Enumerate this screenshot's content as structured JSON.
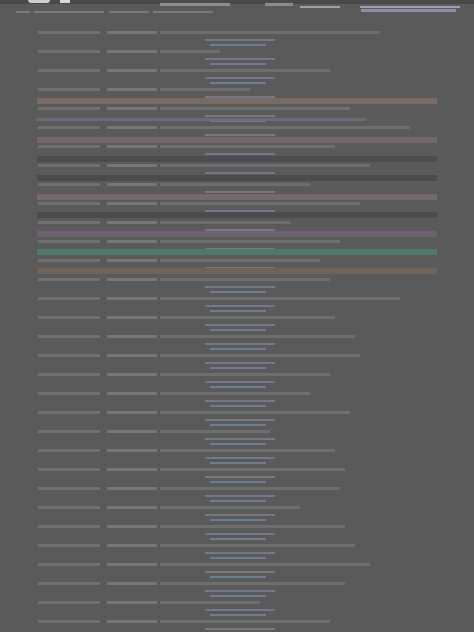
{
  "window": {
    "title": ""
  },
  "header": {
    "left_text": "",
    "right_link": ""
  },
  "list": {
    "entries": [
      {
        "date": "",
        "id": "",
        "title": "",
        "meta": "",
        "link": ""
      },
      {
        "date": "",
        "id": "",
        "title": "",
        "meta": "",
        "link": ""
      },
      {
        "date": "",
        "id": "",
        "title": "",
        "meta": "",
        "link": ""
      },
      {
        "date": "",
        "id": "",
        "title": "",
        "meta": "",
        "link": ""
      },
      {
        "date": "",
        "id": "",
        "title": "",
        "meta": "",
        "link": ""
      },
      {
        "date": "",
        "id": "",
        "title": "",
        "meta": "",
        "link": ""
      },
      {
        "date": "",
        "id": "",
        "title": "",
        "meta": "",
        "link": ""
      },
      {
        "date": "",
        "id": "",
        "title": "",
        "meta": "",
        "link": ""
      },
      {
        "date": "",
        "id": "",
        "title": "",
        "meta": "",
        "link": ""
      },
      {
        "date": "",
        "id": "",
        "title": "",
        "meta": "",
        "link": ""
      },
      {
        "date": "",
        "id": "",
        "title": "",
        "meta": "",
        "link": ""
      },
      {
        "date": "",
        "id": "",
        "title": "",
        "meta": "",
        "link": ""
      },
      {
        "date": "",
        "id": "",
        "title": "",
        "meta": "",
        "link": ""
      },
      {
        "date": "",
        "id": "",
        "title": "",
        "meta": "",
        "link": ""
      },
      {
        "date": "",
        "id": "",
        "title": "",
        "meta": "",
        "link": ""
      },
      {
        "date": "",
        "id": "",
        "title": "",
        "meta": "",
        "link": ""
      },
      {
        "date": "",
        "id": "",
        "title": "",
        "meta": "",
        "link": ""
      },
      {
        "date": "",
        "id": "",
        "title": "",
        "meta": "",
        "link": ""
      },
      {
        "date": "",
        "id": "",
        "title": "",
        "meta": "",
        "link": ""
      },
      {
        "date": "",
        "id": "",
        "title": "",
        "meta": "",
        "link": ""
      }
    ]
  },
  "colors": {
    "background": "#5a5a5a",
    "highlight_band": "#7a6a66",
    "highlight_green": "#4f7a67",
    "link": "#6f7d93"
  }
}
